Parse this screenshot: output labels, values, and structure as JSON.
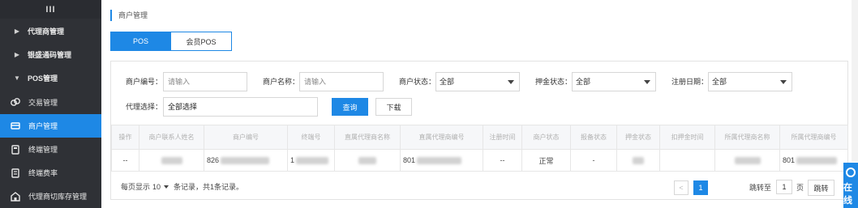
{
  "sidebar": {
    "toggle_icon": "menu-icon",
    "items": [
      {
        "label": "代理商管理",
        "icon": "chevron-right",
        "type": "group"
      },
      {
        "label": "银盛通码管理",
        "icon": "chevron-right",
        "type": "group"
      },
      {
        "label": "POS管理",
        "icon": "chevron-down",
        "type": "group-open"
      },
      {
        "label": "交易管理",
        "icon": "trade-icon",
        "type": "leaf"
      },
      {
        "label": "商户管理",
        "icon": "merchant-icon",
        "type": "leaf",
        "active": true
      },
      {
        "label": "终端管理",
        "icon": "terminal-icon",
        "type": "leaf"
      },
      {
        "label": "终端费率",
        "icon": "rate-icon",
        "type": "leaf"
      },
      {
        "label": "代理商切库存管理",
        "icon": "inventory-icon",
        "type": "leaf"
      }
    ]
  },
  "breadcrumb": "商户管理",
  "tabs": [
    {
      "label": "POS",
      "active": true
    },
    {
      "label": "会员POS",
      "active": false
    }
  ],
  "filters": {
    "merchant_no_label": "商户编号：",
    "merchant_no_placeholder": "请输入",
    "merchant_name_label": "商户名称：",
    "merchant_name_placeholder": "请输入",
    "merchant_status_label": "商户状态：",
    "merchant_status_value": "全部",
    "deposit_status_label": "押金状态：",
    "deposit_status_value": "全部",
    "register_date_label": "注册日期：",
    "register_date_value": "全部",
    "agent_select_label": "代理选择：",
    "agent_select_value": "全部选择",
    "query_button": "查询",
    "export_button": "下载"
  },
  "table": {
    "headers": [
      "操作",
      "商户联系人姓名",
      "商户编号",
      "终端号",
      "直属代理商名称",
      "直属代理商编号",
      "注册时间",
      "商户状态",
      "报备状态",
      "押金状态",
      "扣押金时间",
      "所属代理商名称",
      "所属代理商编号"
    ],
    "rows": [
      [
        "--",
        "",
        "826",
        "1",
        "",
        "801",
        "--",
        "正常",
        "-",
        "",
        "",
        "",
        "801"
      ]
    ]
  },
  "pagination": {
    "per_page_prefix": "每页显示",
    "per_page_value": "10",
    "summary": "条记录，共1条记录。",
    "prev": "<",
    "current_page": "1",
    "jump_prefix": "跳转至",
    "jump_value": "1",
    "jump_suffix": "页",
    "jump_button": "跳转"
  },
  "floating_service": {
    "label": "在线"
  },
  "colors": {
    "accent": "#1e88e5",
    "sidebar_bg": "#2f3136"
  }
}
